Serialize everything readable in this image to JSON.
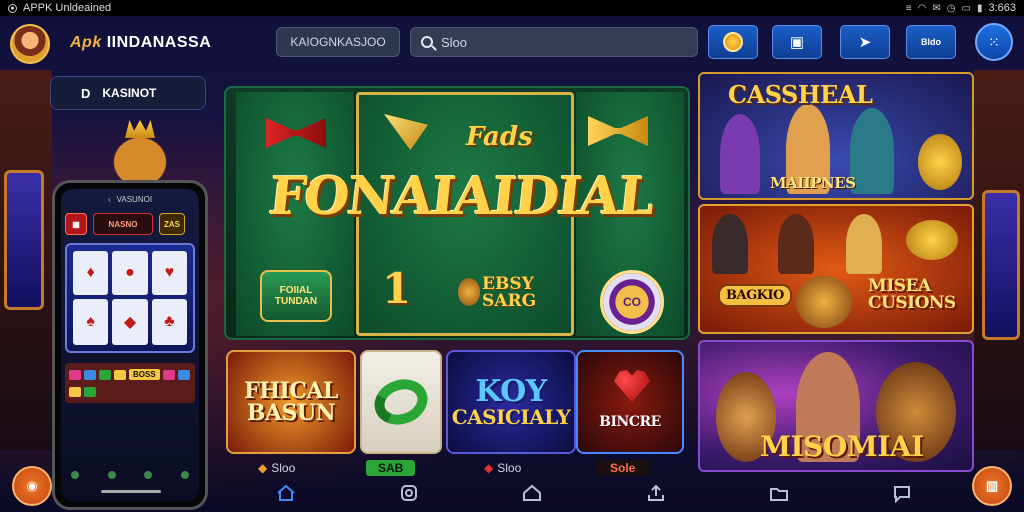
{
  "status_bar": {
    "title": "APPK Unldeained",
    "time": "3:663"
  },
  "header": {
    "app_name_accent": "Apk",
    "app_name": "IINDANASSA",
    "pill_label": "KAIOGNKASJOO",
    "search_placeholder": "Sloo",
    "btn_small_text": "Bldo"
  },
  "left": {
    "tab_label": "KASINOT",
    "tab_glyph": "D",
    "phone": {
      "top_text": "VASUNOI",
      "chip_mid": "NASNO",
      "chip_right": "ZAS",
      "key_label": "BOSS"
    }
  },
  "featured": {
    "small_title": "Fads",
    "title": "FONAIAIDIAL",
    "badge_text": "FOIIAL TUNDAN",
    "number": "1",
    "easy_line1": "EBSY",
    "easy_line2": "SARG",
    "chip_text": "CO"
  },
  "tiles": [
    {
      "label_line1": "FHICAL",
      "label_line2": "BASUN",
      "tag": "Sloo"
    },
    {
      "label_line1": "",
      "label_line2": "",
      "tag": "SAB"
    },
    {
      "label_line1": "KOY",
      "label_line2": "CASICIALY",
      "tag": "Sloo"
    },
    {
      "label_line1": "BINCRE",
      "label_line2": "",
      "tag": "Sole"
    }
  ],
  "right": {
    "card1_top": "CASSHEAL",
    "card1_bottom": "MAIIPNES",
    "card2_left": "BAGKIO",
    "card2_right_line1": "MISEA",
    "card2_right_line2": "CUSIONS",
    "card3_title": "MISOMIAI"
  },
  "colors": {
    "accent_gold": "#ffd24a",
    "nav_blue": "#1b5fc7",
    "active_nav": "#3a8aff",
    "fab_orange": "#f07a2a"
  },
  "icons": {
    "header_buttons": [
      "coin-icon",
      "wallet-icon",
      "send-icon",
      "bldo-icon"
    ],
    "menu": "dots-menu-icon",
    "bottom_nav": [
      "home-icon",
      "record-icon",
      "lobby-icon",
      "upload-icon",
      "folder-icon",
      "chat-icon"
    ]
  }
}
